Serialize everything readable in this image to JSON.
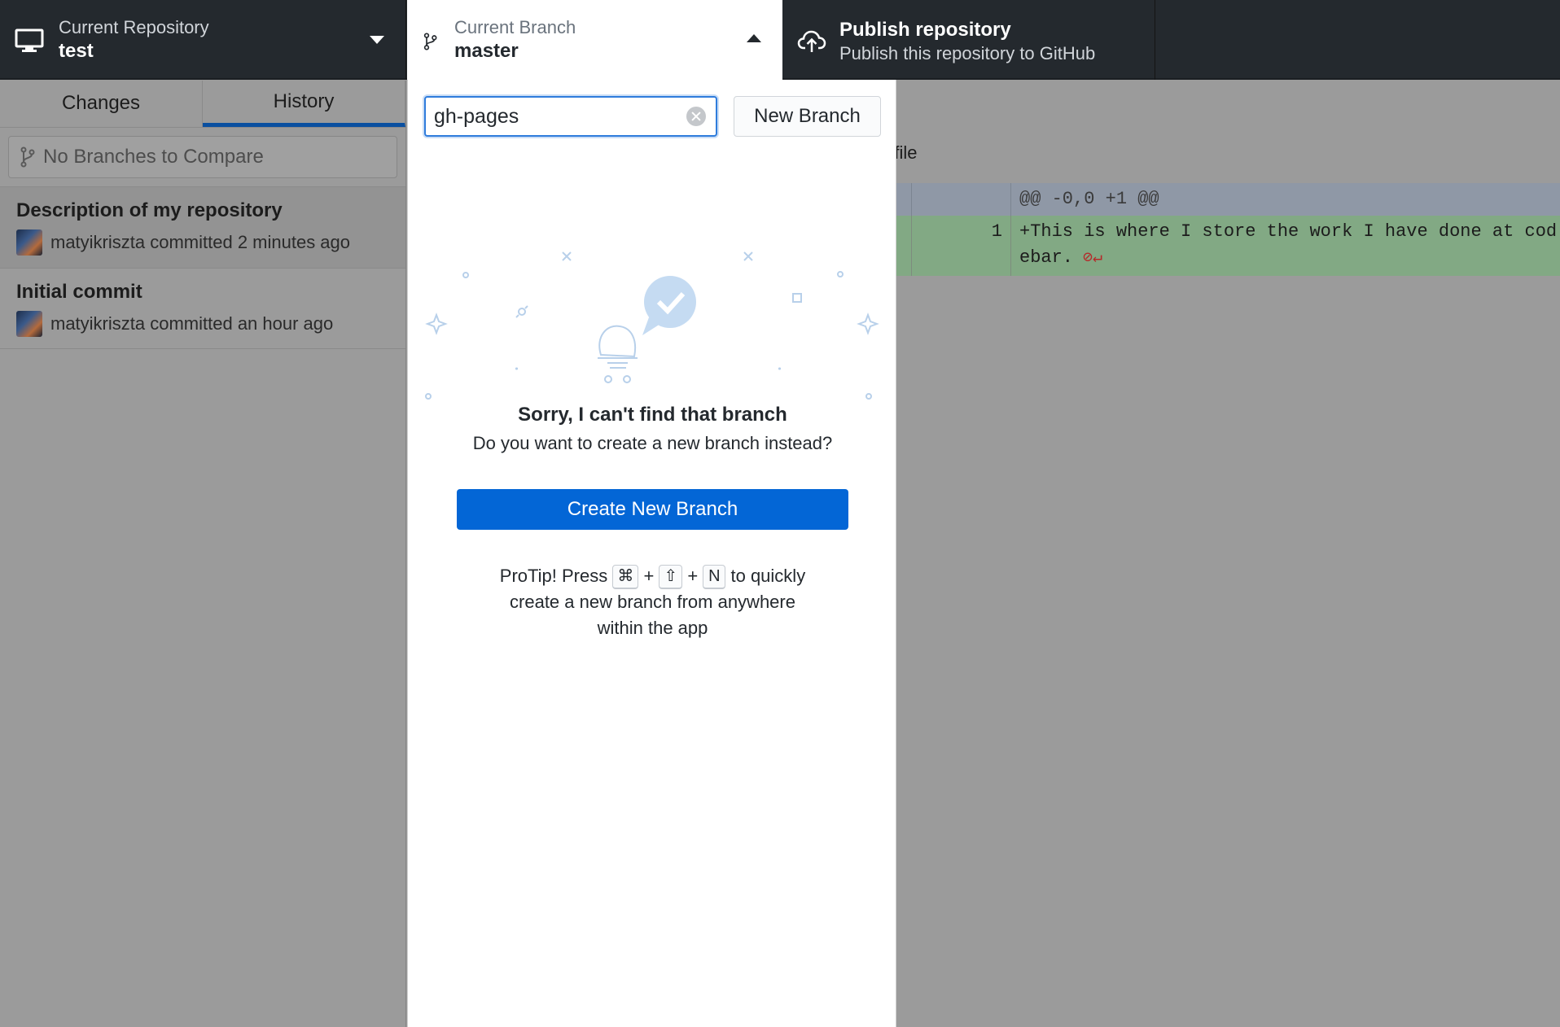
{
  "toolbar": {
    "repository": {
      "label": "Current Repository",
      "value": "test",
      "icon": "desktop-icon"
    },
    "branch": {
      "label": "Current Branch",
      "value": "master",
      "icon": "git-branch-icon"
    },
    "publish": {
      "title": "Publish repository",
      "subtitle": "Publish this repository to GitHub",
      "icon": "cloud-upload-icon"
    }
  },
  "sidebar": {
    "tabs": [
      {
        "label": "Changes",
        "active": false
      },
      {
        "label": "History",
        "active": true
      }
    ],
    "compare_placeholder": "No Branches to Compare",
    "commits": [
      {
        "title": "Description of my repository",
        "author": "matyikriszta",
        "meta": "matyikriszta committed 2 minutes ago",
        "selected": true
      },
      {
        "title": "Initial commit",
        "author": "matyikriszta",
        "meta": "matyikriszta committed an hour ago",
        "selected": false
      }
    ]
  },
  "diff": {
    "file_label_fragment": "d file",
    "hunk_header": "@@ -0,0 +1 @@",
    "lines": [
      {
        "number": "1",
        "text": "+This is where I store the work I have done at cod\nebar."
      }
    ],
    "colors": {
      "hunk": "#8f98a6",
      "addition": "#82a984"
    }
  },
  "popover": {
    "filter_value": "gh-pages",
    "new_branch_label": "New Branch",
    "empty_title": "Sorry, I can't find that branch",
    "empty_description": "Do you want to create a new branch instead?",
    "create_button_label": "Create New Branch",
    "protip": {
      "prefix": "ProTip! Press",
      "keys": [
        "⌘",
        "⇧",
        "N"
      ],
      "plus": "+",
      "suffix_line1": "to quickly",
      "line2": "create a new branch from anywhere",
      "line3": "within the app"
    },
    "colors": {
      "primary": "#0366d6",
      "focus": "#2f7cdc"
    }
  }
}
